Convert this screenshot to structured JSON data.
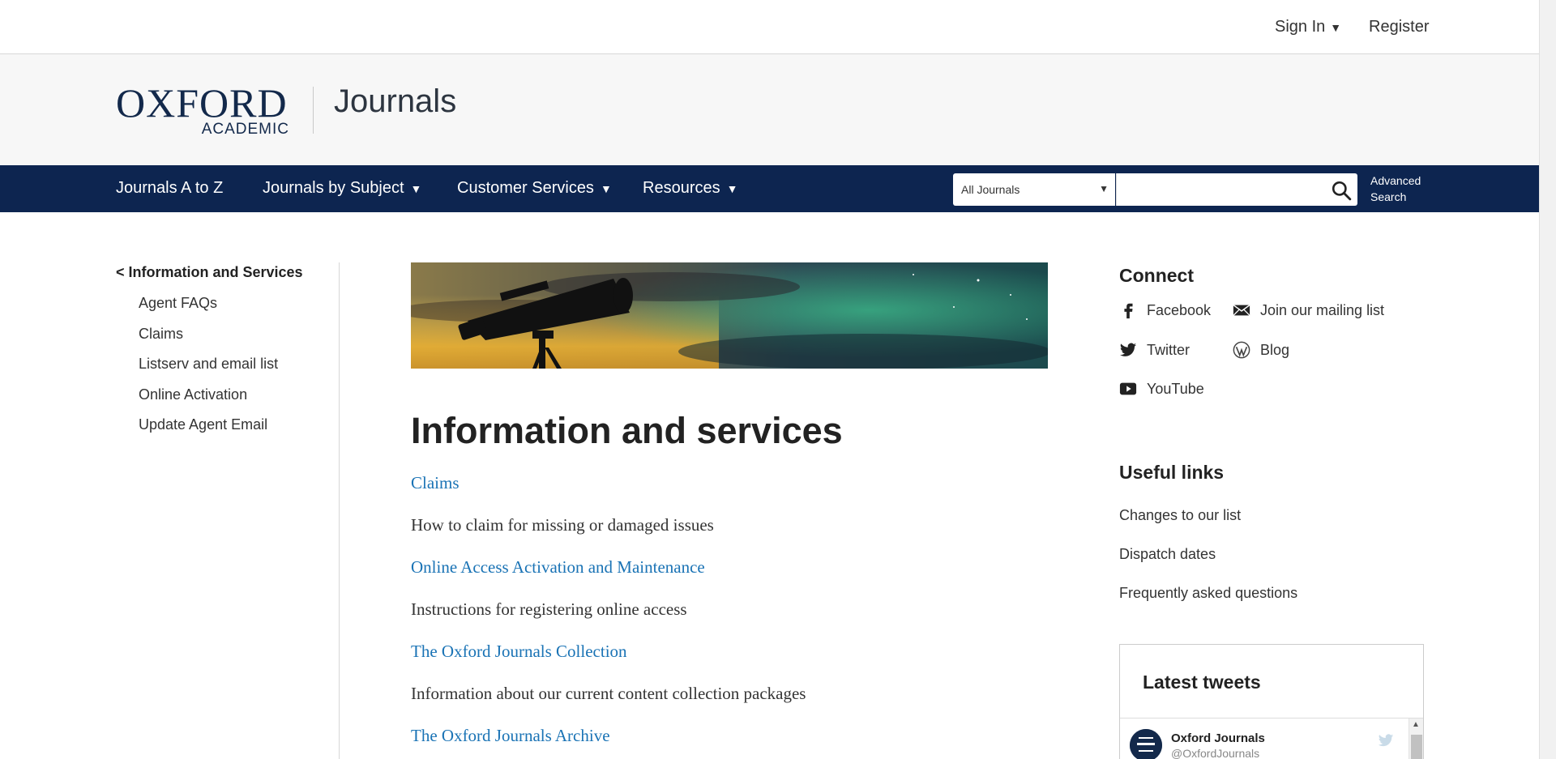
{
  "topbar": {
    "sign_in": "Sign In",
    "sign_in_caret": "▼",
    "register": "Register"
  },
  "header": {
    "logo_main": "OXFORD",
    "logo_sub": "ACADEMIC",
    "site_name": "Journals"
  },
  "nav": {
    "items": [
      {
        "label": "Journals A to Z",
        "caret": ""
      },
      {
        "label": "Journals by Subject",
        "caret": "▼"
      },
      {
        "label": "Customer Services",
        "caret": "▼"
      },
      {
        "label": "Resources",
        "caret": "▼"
      }
    ],
    "search": {
      "scope": "All Journals",
      "scope_caret": "▼",
      "placeholder": "",
      "advanced_line1": "Advanced",
      "advanced_line2": "Search"
    }
  },
  "sidebar": {
    "parent": "< Information and Services",
    "items": [
      {
        "label": "Agent FAQs"
      },
      {
        "label": "Claims"
      },
      {
        "label": "Listserv and email list"
      },
      {
        "label": "Online Activation"
      },
      {
        "label": "Update Agent Email"
      }
    ]
  },
  "main": {
    "title": "Information and services",
    "links": [
      {
        "label": "Claims",
        "description": "How to claim for missing or damaged issues"
      },
      {
        "label": "Online Access Activation and Maintenance",
        "description": "Instructions for registering online access"
      },
      {
        "label": "The Oxford Journals Collection",
        "description": "Information about our current content collection packages"
      },
      {
        "label": "The Oxford Journals Archive",
        "description": ""
      }
    ]
  },
  "connect": {
    "heading": "Connect",
    "items": [
      {
        "label": "Facebook",
        "icon": "facebook-icon"
      },
      {
        "label": "Join our mailing list",
        "icon": "mail-icon"
      },
      {
        "label": "Twitter",
        "icon": "twitter-icon"
      },
      {
        "label": "Blog",
        "icon": "wordpress-icon"
      },
      {
        "label": "YouTube",
        "icon": "youtube-icon"
      }
    ]
  },
  "useful_links": {
    "heading": "Useful links",
    "items": [
      {
        "label": "Changes to our list"
      },
      {
        "label": "Dispatch dates"
      },
      {
        "label": "Frequently asked questions"
      }
    ]
  },
  "tweets": {
    "heading": "Latest tweets",
    "author": "Oxford Journals",
    "handle": "@OxfordJournals"
  },
  "colors": {
    "nav_bg": "#0d2550",
    "brand_navy": "#13294b",
    "link_blue": "#1a73b5",
    "header_bg": "#f7f7f7"
  }
}
